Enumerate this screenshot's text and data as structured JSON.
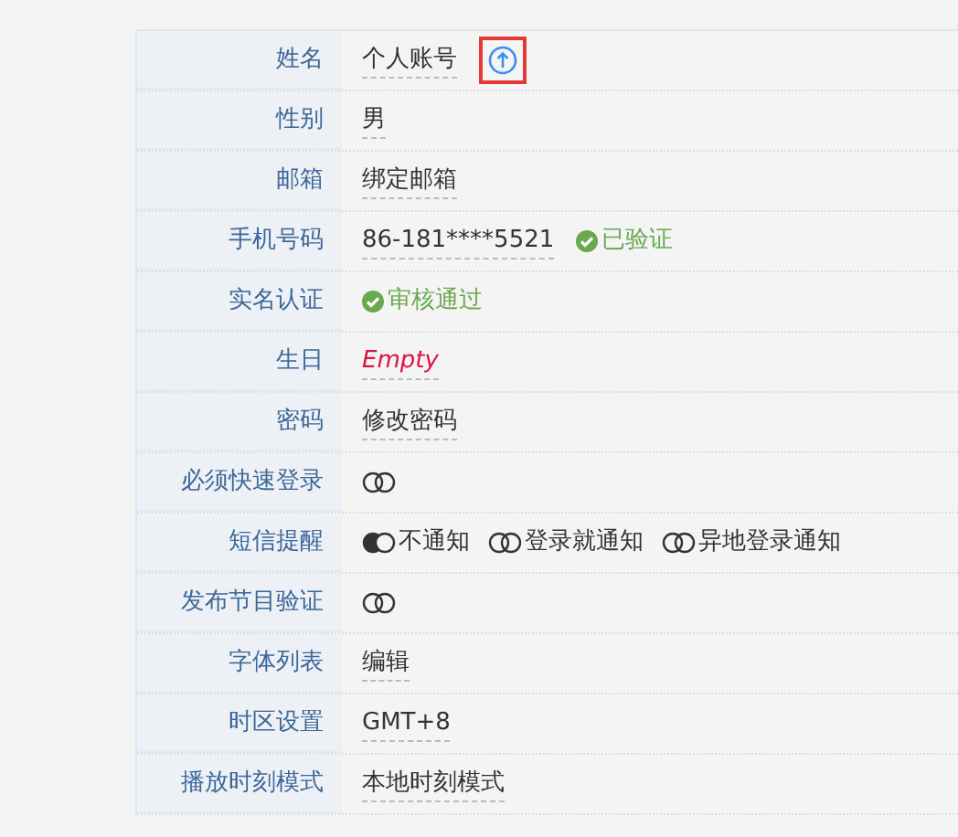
{
  "rows": [
    {
      "label": "姓名",
      "kind": "link",
      "value": "个人账号",
      "upload": true,
      "highlighted": true
    },
    {
      "label": "性别",
      "kind": "link",
      "value": "男"
    },
    {
      "label": "邮箱",
      "kind": "link",
      "value": "绑定邮箱"
    },
    {
      "label": "手机号码",
      "kind": "link",
      "value": "86-181****5521",
      "status": "已验证"
    },
    {
      "label": "实名认证",
      "kind": "status",
      "status": "审核通过"
    },
    {
      "label": "生日",
      "kind": "empty",
      "value": "Empty"
    },
    {
      "label": "密码",
      "kind": "link",
      "value": "修改密码"
    },
    {
      "label": "必须快速登录",
      "kind": "toggle",
      "on": false
    },
    {
      "label": "短信提醒",
      "kind": "radios",
      "options": [
        {
          "label": "不通知",
          "selected": true
        },
        {
          "label": "登录就通知",
          "selected": false
        },
        {
          "label": "异地登录通知",
          "selected": false
        }
      ]
    },
    {
      "label": "发布节目验证",
      "kind": "toggle",
      "on": false
    },
    {
      "label": "字体列表",
      "kind": "link",
      "value": "编辑"
    },
    {
      "label": "时区设置",
      "kind": "link",
      "value": "GMT+8"
    },
    {
      "label": "播放时刻模式",
      "kind": "link",
      "value": "本地时刻模式"
    }
  ]
}
